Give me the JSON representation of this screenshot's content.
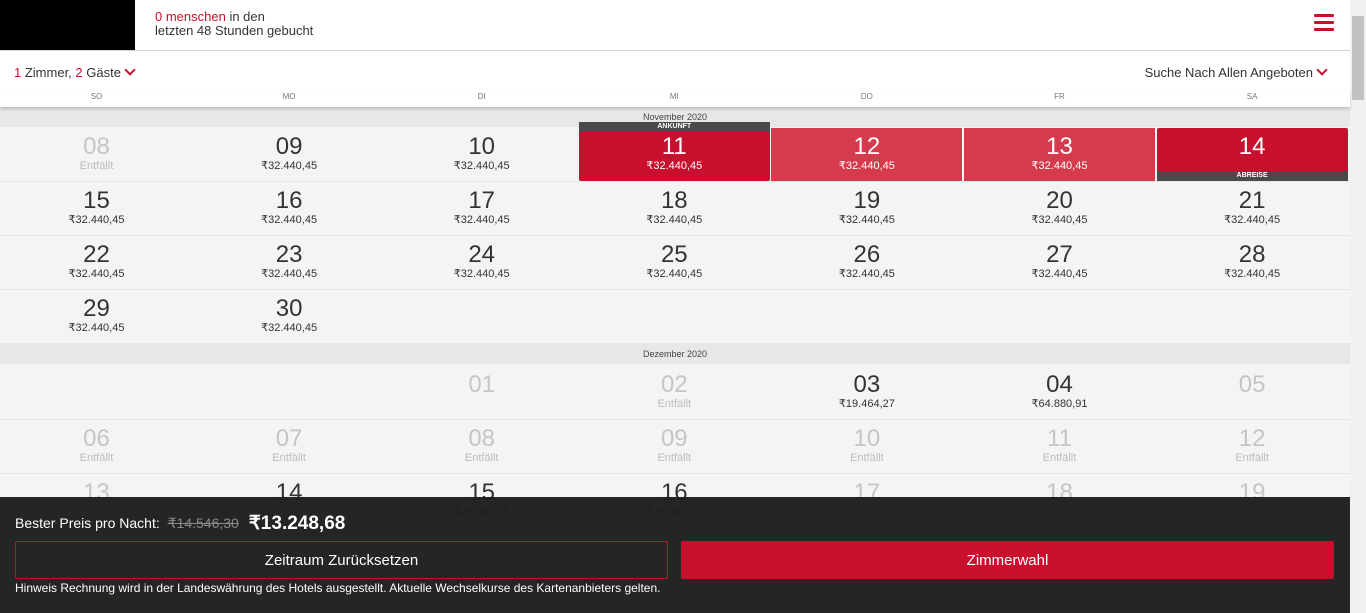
{
  "header": {
    "booked_count": "0 menschen",
    "booked_in": " in den",
    "booked_line2": "letzten 48 Stunden gebucht"
  },
  "selector": {
    "rooms_count": "1",
    "rooms_label": " Zimmer, ",
    "guests_count": "2",
    "guests_label": " Gäste",
    "search_label": "Suche Nach Allen Angeboten"
  },
  "weekdays": [
    "SO",
    "MO",
    "DI",
    "MI",
    "DO",
    "FR",
    "SA"
  ],
  "months": [
    {
      "label": "November 2020",
      "weeks": [
        [
          {
            "day": "08",
            "price": "Entfällt",
            "state": "unavail"
          },
          {
            "day": "09",
            "price": "₹32.440,45"
          },
          {
            "day": "10",
            "price": "₹32.440,45"
          },
          {
            "day": "11",
            "price": "₹32.440,45",
            "state": "sel",
            "tag_top": "ANKUNFT"
          },
          {
            "day": "12",
            "price": "₹32.440,45",
            "state": "range"
          },
          {
            "day": "13",
            "price": "₹32.440,45",
            "state": "range"
          },
          {
            "day": "14",
            "price": "",
            "state": "sel",
            "tag_bottom": "ABREISE"
          }
        ],
        [
          {
            "day": "15",
            "price": "₹32.440,45"
          },
          {
            "day": "16",
            "price": "₹32.440,45"
          },
          {
            "day": "17",
            "price": "₹32.440,45"
          },
          {
            "day": "18",
            "price": "₹32.440,45"
          },
          {
            "day": "19",
            "price": "₹32.440,45"
          },
          {
            "day": "20",
            "price": "₹32.440,45"
          },
          {
            "day": "21",
            "price": "₹32.440,45"
          }
        ],
        [
          {
            "day": "22",
            "price": "₹32.440,45"
          },
          {
            "day": "23",
            "price": "₹32.440,45"
          },
          {
            "day": "24",
            "price": "₹32.440,45"
          },
          {
            "day": "25",
            "price": "₹32.440,45"
          },
          {
            "day": "26",
            "price": "₹32.440,45"
          },
          {
            "day": "27",
            "price": "₹32.440,45"
          },
          {
            "day": "28",
            "price": "₹32.440,45"
          }
        ],
        [
          {
            "day": "29",
            "price": "₹32.440,45"
          },
          {
            "day": "30",
            "price": "₹32.440,45"
          },
          null,
          null,
          null,
          null,
          null
        ]
      ]
    },
    {
      "label": "Dezember 2020",
      "weeks": [
        [
          null,
          null,
          {
            "day": "01",
            "price": "",
            "state": "unavail"
          },
          {
            "day": "02",
            "price": "Entfällt",
            "state": "unavail"
          },
          {
            "day": "03",
            "price": "₹19.464,27"
          },
          {
            "day": "04",
            "price": "₹64.880,91"
          },
          {
            "day": "05",
            "price": "",
            "state": "unavail"
          }
        ],
        [
          {
            "day": "06",
            "price": "Entfällt",
            "state": "unavail"
          },
          {
            "day": "07",
            "price": "Entfällt",
            "state": "unavail"
          },
          {
            "day": "08",
            "price": "Entfällt",
            "state": "unavail"
          },
          {
            "day": "09",
            "price": "Entfällt",
            "state": "unavail"
          },
          {
            "day": "10",
            "price": "Entfällt",
            "state": "unavail"
          },
          {
            "day": "11",
            "price": "Entfällt",
            "state": "unavail"
          },
          {
            "day": "12",
            "price": "Entfällt",
            "state": "unavail"
          }
        ],
        [
          {
            "day": "13",
            "price": "",
            "state": "unavail"
          },
          {
            "day": "14",
            "price": ""
          },
          {
            "day": "15",
            "price": "₹25.952,36"
          },
          {
            "day": "16",
            "price": "₹25.952,36"
          },
          {
            "day": "17",
            "price": "",
            "state": "unavail"
          },
          {
            "day": "18",
            "price": "",
            "state": "unavail"
          },
          {
            "day": "19",
            "price": "",
            "state": "unavail"
          }
        ]
      ]
    }
  ],
  "panel": {
    "best_label": "Bester Preis pro Nacht:",
    "old_price": "₹14.546,30",
    "current_price": "₹13.248,68",
    "reset_label": "Zeitraum Zurücksetzen",
    "rooms_label": "Zimmerwahl",
    "note": "Hinweis Rechnung wird in der Landeswährung des Hotels ausgestellt. Aktuelle Wechselkurse des Kartenanbieters gelten."
  },
  "colors": {
    "accent": "#c8102e",
    "range": "#d63b4d",
    "panel_bg": "#1e1e1e"
  }
}
